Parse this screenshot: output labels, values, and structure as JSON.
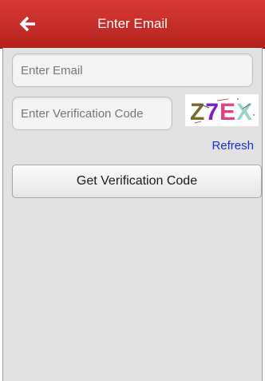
{
  "header": {
    "title": "Enter Email",
    "back_icon": "left-arrow-icon",
    "color": "#c92d29"
  },
  "form": {
    "email_placeholder": "Enter Email",
    "code_placeholder": "Enter Verification Code",
    "captcha_text": "Z7EX",
    "refresh_label": "Refresh",
    "get_code_label": "Get Verification Code"
  }
}
